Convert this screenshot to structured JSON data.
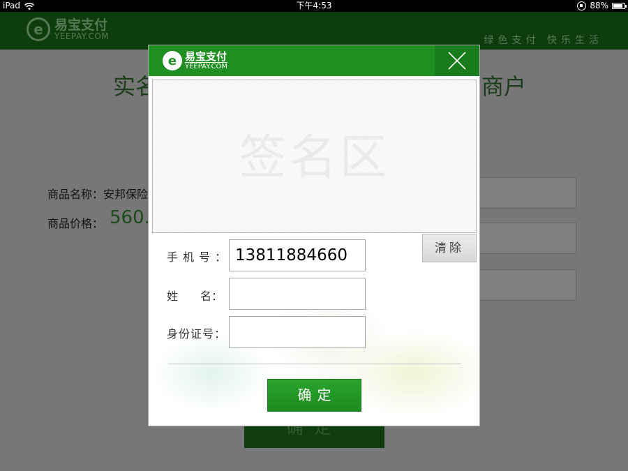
{
  "status_bar": {
    "device": "iPad",
    "time": "下午4:53",
    "battery": "88%"
  },
  "background": {
    "logo_cn": "易宝支付",
    "logo_en": "YEEPAY.COM",
    "slogan": "绿色支付 快乐生活",
    "title_left": "实名",
    "title_right": "商户",
    "label_product": "商品名称：安邦保险",
    "label_price": "商品价格：",
    "price_value": "560.0",
    "button": "确定"
  },
  "dialog": {
    "logo_cn": "易宝支付",
    "logo_en": "YEEPAY.COM",
    "sign_area_label": "签名区",
    "clear_button": "清除",
    "phone_label": "手机号：",
    "phone_value": "13811884660",
    "name_label": "姓　　名：",
    "name_value": "",
    "id_label": "身份证号：",
    "id_value": "",
    "confirm_button": "确定"
  },
  "colors": {
    "brand_green": "#1f8f22",
    "dark_green": "#0d3d0d"
  }
}
